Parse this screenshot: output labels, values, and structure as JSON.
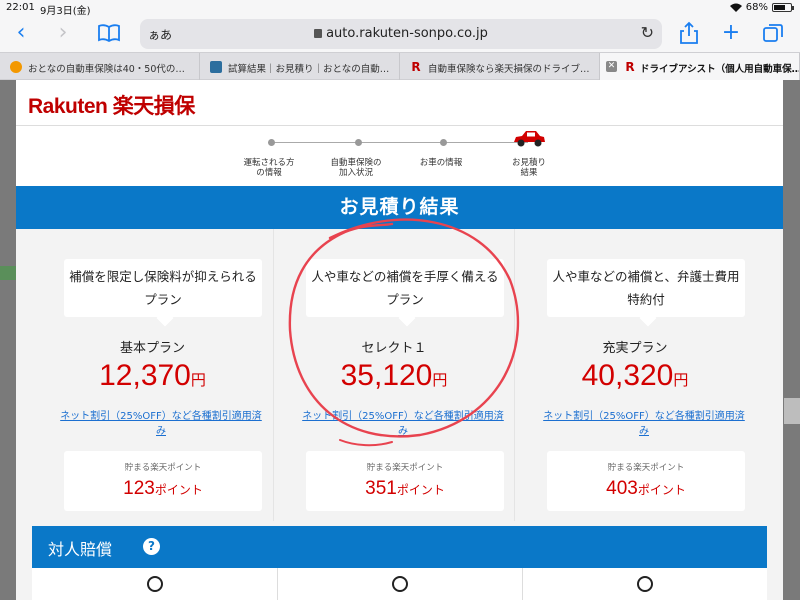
{
  "status": {
    "time": "22:01",
    "date": "9月3日(金)",
    "battery": "68%",
    "battery_level": 0.68
  },
  "toolbar": {
    "aa_label": "ぁあ",
    "url": "auto.rakuten-sonpo.co.jp"
  },
  "tabs": [
    {
      "title": "おとなの自動車保険は40・50代の…"
    },
    {
      "title": "試算結果｜お見積り｜おとなの自動…"
    },
    {
      "title": "自動車保険なら楽天損保のドライブ…"
    },
    {
      "title": "ドライブアシスト（個人用自動車保…"
    }
  ],
  "header": {
    "logo_latin": "Rakuten",
    "logo_kanji": "楽天損保"
  },
  "steps": [
    {
      "label_line1": "運転される方",
      "label_line2": "の情報"
    },
    {
      "label_line1": "自動車保険の",
      "label_line2": "加入状況"
    },
    {
      "label_line1": "お車の情報",
      "label_line2": ""
    },
    {
      "label_line1": "お見積り",
      "label_line2": "結果"
    }
  ],
  "banner": {
    "title": "お見積り結果"
  },
  "plans": [
    {
      "desc_line1": "補償を限定し保険料が抑えられる",
      "desc_line2": "プラン",
      "name": "基本プラン",
      "price": "12,370",
      "yen": "円",
      "discount_line1": "ネット割引（25%OFF）など各種割引適用済",
      "discount_line2": "み",
      "points_label": "貯まる楽天ポイント",
      "points": "123",
      "points_unit": "ポイント"
    },
    {
      "desc_line1": "人や車などの補償を手厚く備える",
      "desc_line2": "プラン",
      "name": "セレクト１",
      "price": "35,120",
      "yen": "円",
      "discount_line1": "ネット割引（25%OFF）など各種割引適用済",
      "discount_line2": "み",
      "points_label": "貯まる楽天ポイント",
      "points": "351",
      "points_unit": "ポイント"
    },
    {
      "desc_line1": "人や車などの補償と、弁護士費用",
      "desc_line2": "特約付",
      "name": "充実プラン",
      "price": "40,320",
      "yen": "円",
      "discount_line1": "ネット割引（25%OFF）など各種割引適用済",
      "discount_line2": "み",
      "points_label": "貯まる楽天ポイント",
      "points": "403",
      "points_unit": "ポイント"
    }
  ],
  "section": {
    "title": "対人賠償",
    "help_glyph": "?"
  },
  "coverage_marks": [
    "○",
    "○",
    "○"
  ],
  "colors": {
    "brand_red": "#bf0000",
    "price_red": "#d20000",
    "banner_blue": "#0a78c8",
    "link_blue": "#1b6fd0",
    "ios_blue": "#1a7ef0",
    "annotation_red": "#e8434f"
  }
}
